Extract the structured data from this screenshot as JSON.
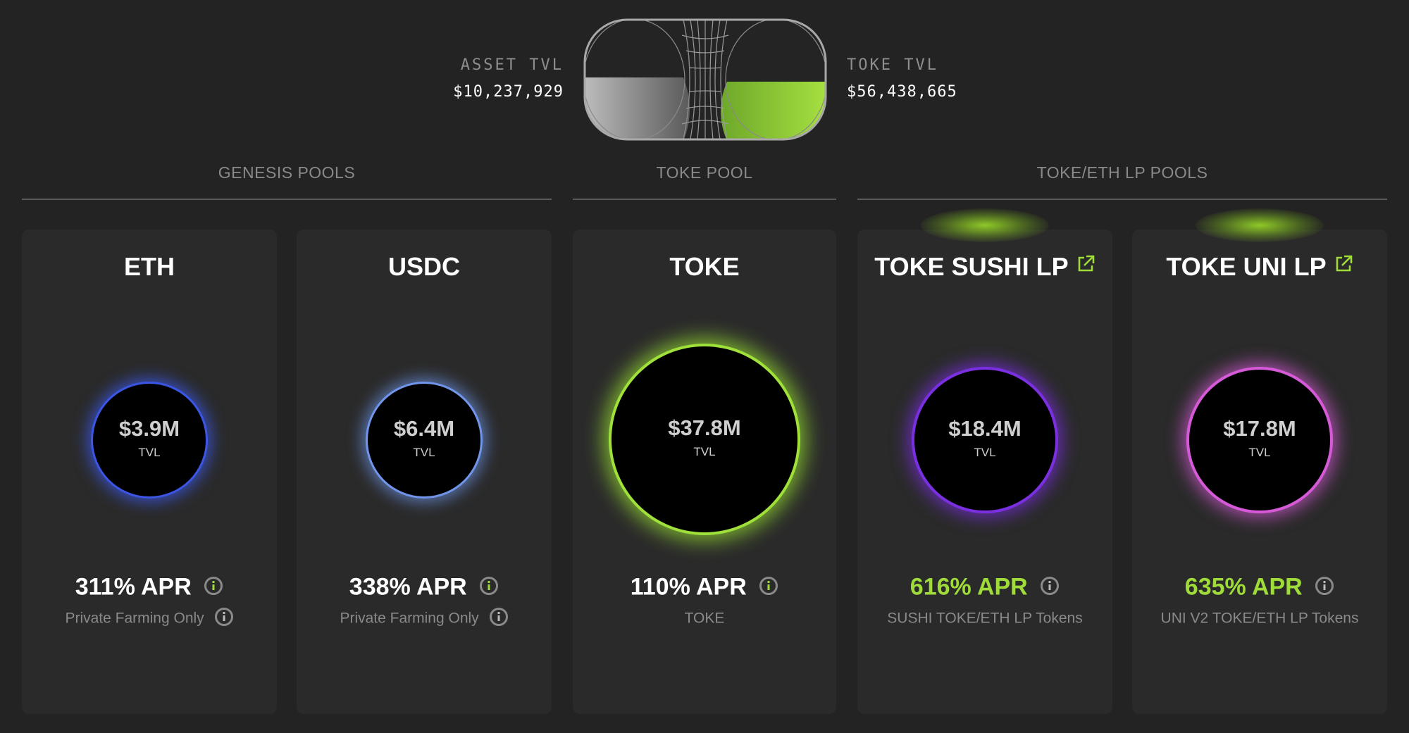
{
  "header": {
    "asset_tvl_label": "ASSET TVL",
    "asset_tvl_value": "$10,237,929",
    "toke_tvl_label": "TOKE TVL",
    "toke_tvl_value": "$56,438,665"
  },
  "sections": {
    "genesis": "GENESIS POOLS",
    "toke": "TOKE POOL",
    "lp": "TOKE/ETH LP POOLS"
  },
  "colors": {
    "accent_green": "#9fdc3a",
    "eth_glow": "#3a55e0",
    "usdc_glow": "#6f93e6",
    "toke_glow": "#9fe03a",
    "sushi_glow": "#7a2fe0",
    "uni_glow": "#d65ad8"
  },
  "icons": {
    "info": "info-icon",
    "external_link": "external-link-icon"
  },
  "pools": [
    {
      "title": "ETH",
      "tvl": "$3.9M",
      "tvl_label": "TVL",
      "apr": "311% APR",
      "subtitle": "Private Farming Only"
    },
    {
      "title": "USDC",
      "tvl": "$6.4M",
      "tvl_label": "TVL",
      "apr": "338% APR",
      "subtitle": "Private Farming Only"
    },
    {
      "title": "TOKE",
      "tvl": "$37.8M",
      "tvl_label": "TVL",
      "apr": "110% APR",
      "subtitle": "TOKE"
    },
    {
      "title": "TOKE SUSHI LP",
      "tvl": "$18.4M",
      "tvl_label": "TVL",
      "apr": "616% APR",
      "subtitle": "SUSHI TOKE/ETH LP Tokens"
    },
    {
      "title": "TOKE UNI LP",
      "tvl": "$17.8M",
      "tvl_label": "TVL",
      "apr": "635% APR",
      "subtitle": "UNI V2 TOKE/ETH LP Tokens"
    }
  ]
}
